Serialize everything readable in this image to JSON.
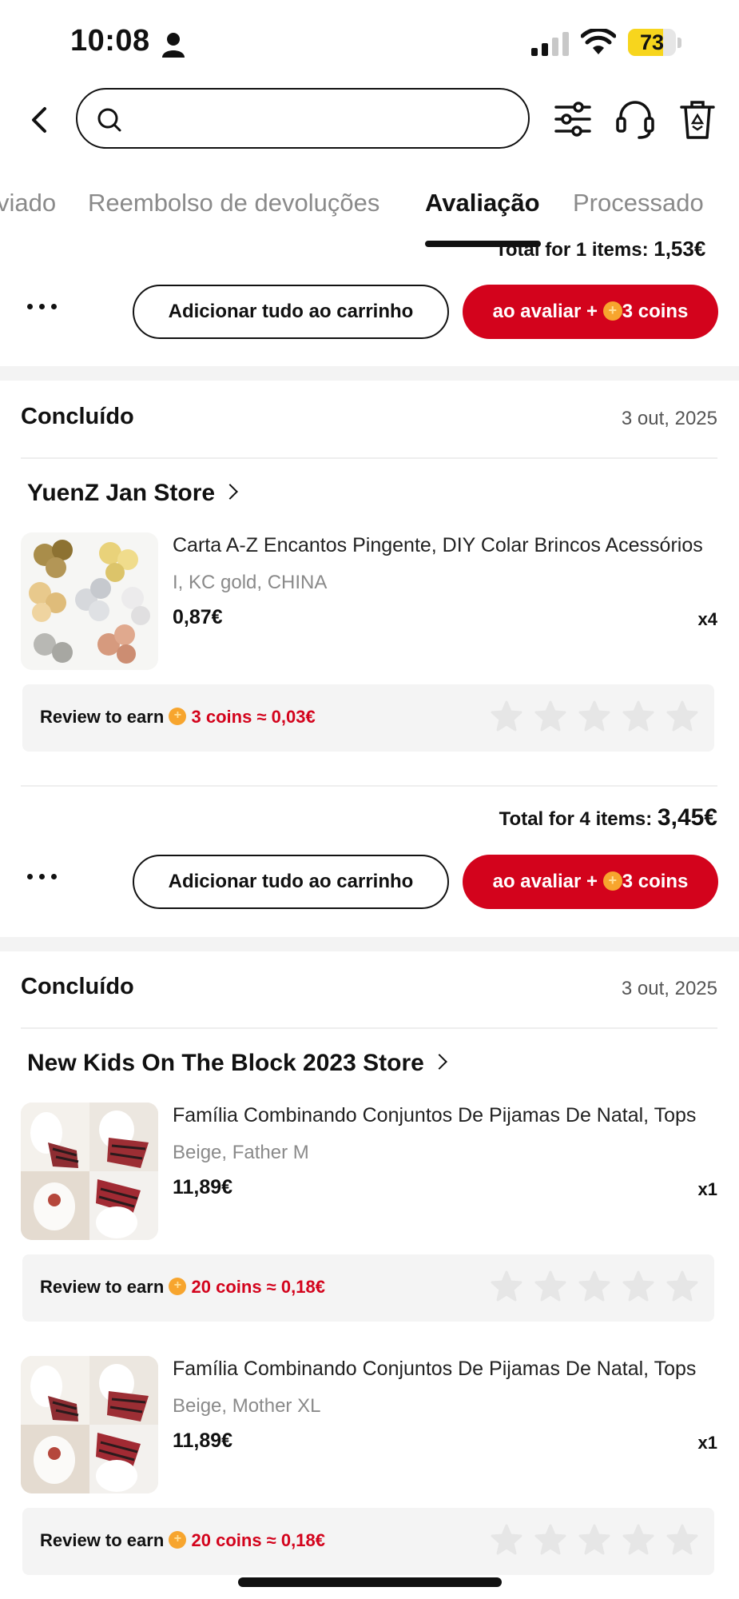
{
  "status_bar": {
    "time": "10:08",
    "battery": "73",
    "battery_level": 0.73
  },
  "header": {
    "search": {
      "value": "",
      "placeholder": ""
    }
  },
  "tabs": [
    {
      "label": "viado",
      "active": false
    },
    {
      "label": "Reembolso de devoluções",
      "active": false
    },
    {
      "label": "Avaliação",
      "active": true
    },
    {
      "label": "Processado",
      "active": false
    }
  ],
  "partial_order": {
    "total_label": "Total for 1 items:",
    "total_amount": "1,53€",
    "add_all_label": "Adicionar tudo ao carrinho",
    "review_btn_prefix": "ao avaliar +",
    "review_btn_suffix": "3 coins"
  },
  "orders": [
    {
      "status": "Concluído",
      "date": "3 out, 2025",
      "store": "YuenZ Jan Store",
      "items": [
        {
          "title": "Carta A-Z Encantos Pingente, DIY Colar Brincos Acessórios",
          "variant": "I, KC gold, CHINA",
          "price": "0,87€",
          "qty": "x4",
          "review_label": "Review to earn",
          "review_earn": "3 coins ≈ 0,03€"
        }
      ],
      "total_label": "Total for 4 items:",
      "total_amount": "3,45€",
      "add_all_label": "Adicionar tudo ao carrinho",
      "review_btn_prefix": "ao avaliar +",
      "review_btn_suffix": "3 coins"
    },
    {
      "status": "Concluído",
      "date": "3 out, 2025",
      "store": "New Kids On The Block 2023 Store",
      "items": [
        {
          "title": "Família Combinando Conjuntos De Pijamas De Natal, Tops",
          "variant": "Beige, Father M",
          "price": "11,89€",
          "qty": "x1",
          "review_label": "Review to earn",
          "review_earn": "20 coins ≈ 0,18€"
        },
        {
          "title": "Família Combinando Conjuntos De Pijamas De Natal, Tops",
          "variant": "Beige, Mother XL",
          "price": "11,89€",
          "qty": "x1",
          "review_label": "Review to earn",
          "review_earn": "20 coins ≈ 0,18€"
        }
      ]
    }
  ],
  "icons": {
    "back": "chevron-left-icon",
    "search": "search-icon",
    "filter": "filter-sliders-icon",
    "support": "headset-icon",
    "delete": "trash-icon",
    "coin": "coin-icon",
    "star": "star-icon",
    "more": "more-dots-icon"
  },
  "colors": {
    "accent": "#d3031c",
    "coin": "#f7a52e",
    "star_empty": "#e6e6e6",
    "battery": "#f7d51d"
  }
}
